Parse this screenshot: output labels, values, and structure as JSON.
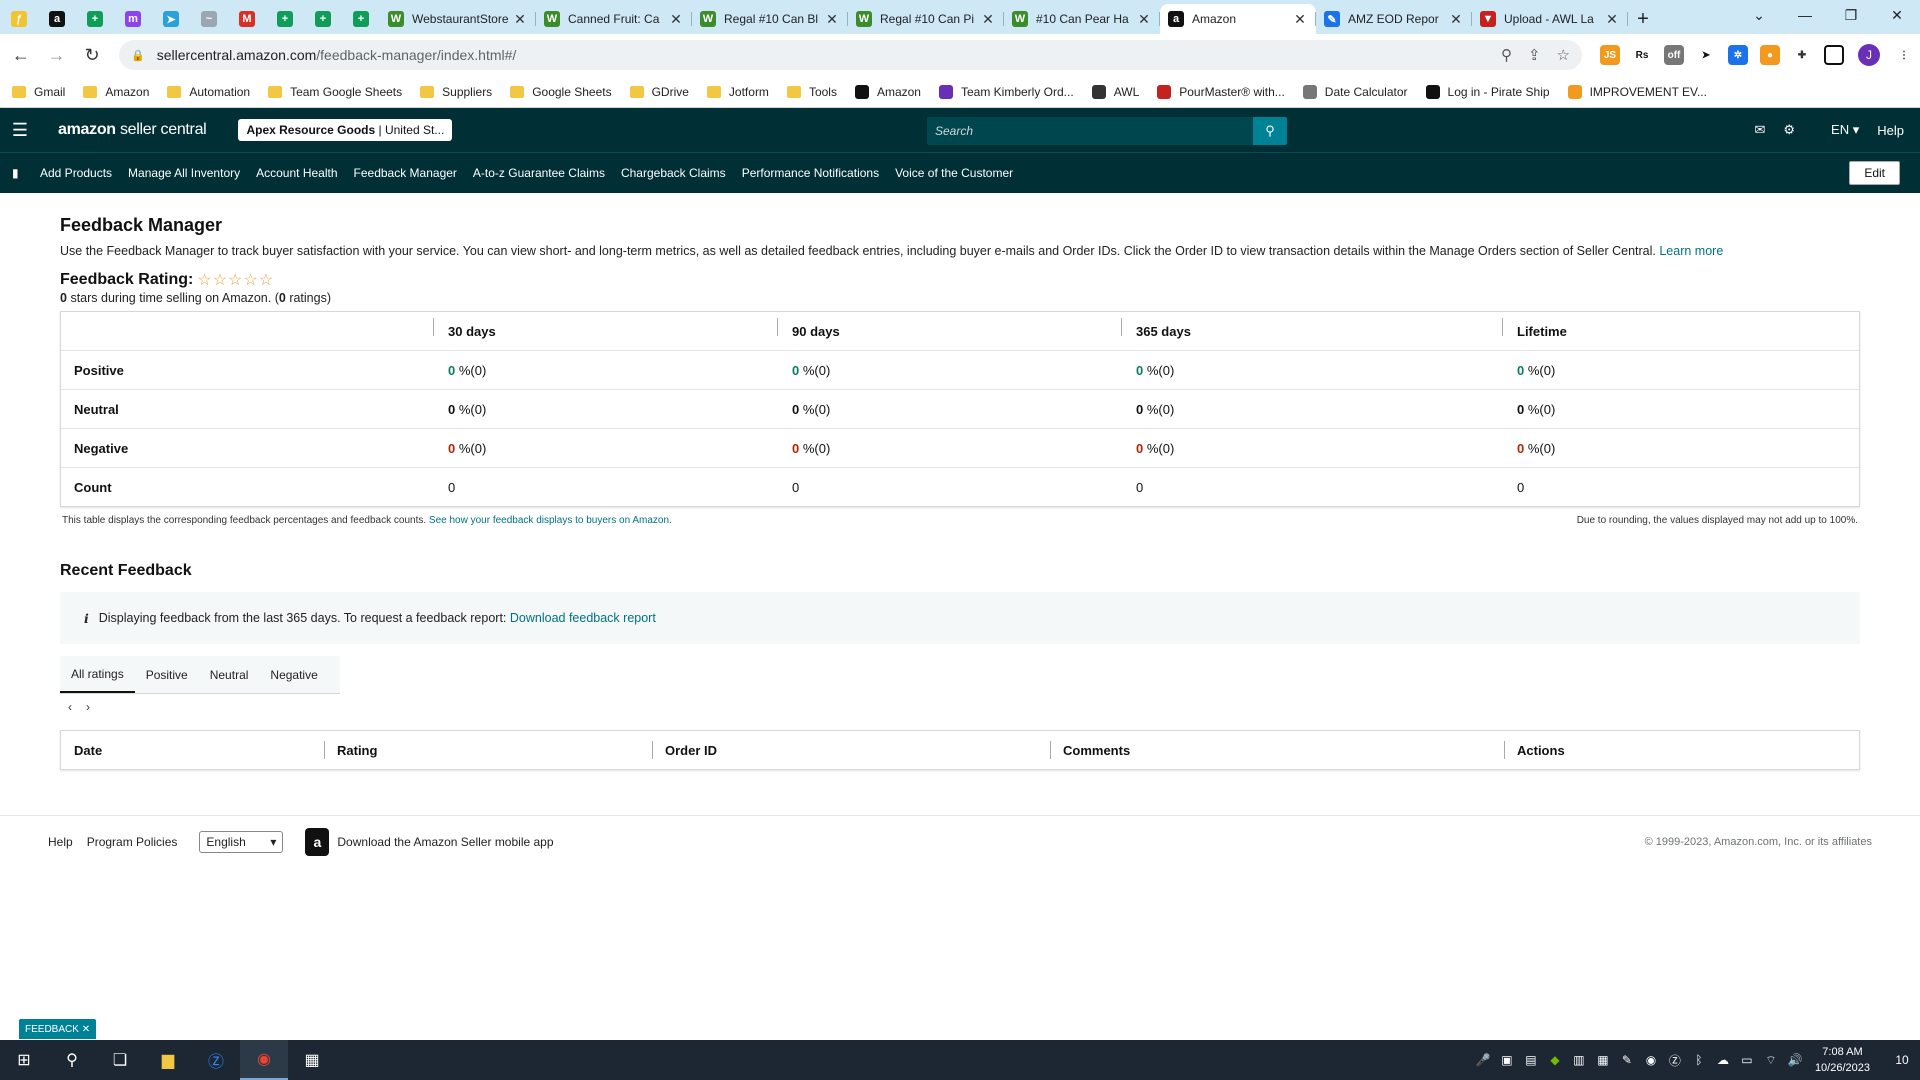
{
  "browser": {
    "pinned_tabs": [
      {
        "icon": "pinned-tab-icon",
        "glyph": "ƒ",
        "color": "#f4c430"
      },
      {
        "icon": "amazon-icon",
        "glyph": "a",
        "color": "#111111"
      },
      {
        "icon": "sheets-icon",
        "glyph": "+",
        "color": "#0f9d58"
      },
      {
        "icon": "messenger-icon",
        "glyph": "m",
        "color": "#8e44ec"
      },
      {
        "icon": "telegram-icon",
        "glyph": "➤",
        "color": "#2aa1da"
      },
      {
        "icon": "extension-icon",
        "glyph": "~",
        "color": "#9aa6b2"
      },
      {
        "icon": "gmail-icon",
        "glyph": "M",
        "color": "#d93025"
      },
      {
        "icon": "sheets-icon",
        "glyph": "+",
        "color": "#0f9d58"
      },
      {
        "icon": "sheets-icon",
        "glyph": "+",
        "color": "#0f9d58"
      },
      {
        "icon": "sheets-icon",
        "glyph": "+",
        "color": "#0f9d58"
      }
    ],
    "tabs": [
      {
        "title": "WebstaurantStore",
        "color": "#3b8c2a",
        "glyph": "W",
        "active": false
      },
      {
        "title": "Canned Fruit: Ca",
        "color": "#3b8c2a",
        "glyph": "W",
        "active": false
      },
      {
        "title": "Regal #10 Can Bl",
        "color": "#3b8c2a",
        "glyph": "W",
        "active": false
      },
      {
        "title": "Regal #10 Can Pi",
        "color": "#3b8c2a",
        "glyph": "W",
        "active": false
      },
      {
        "title": "#10 Can Pear Ha",
        "color": "#3b8c2a",
        "glyph": "W",
        "active": false
      },
      {
        "title": "Amazon",
        "color": "#111111",
        "glyph": "a",
        "active": true
      },
      {
        "title": "AMZ EOD Repor",
        "color": "#1a73e8",
        "glyph": "✎",
        "active": false
      },
      {
        "title": "Upload - AWL La",
        "color": "#c5221f",
        "glyph": "▼",
        "active": false
      }
    ],
    "url_domain": "sellercentral.amazon.com",
    "url_path": "/feedback-manager/index.html#/",
    "profile_initial": "J",
    "bookmarks": [
      {
        "label": "Gmail",
        "type": "folder"
      },
      {
        "label": "Amazon",
        "type": "folder"
      },
      {
        "label": "Automation",
        "type": "folder"
      },
      {
        "label": "Team Google Sheets",
        "type": "folder"
      },
      {
        "label": "Suppliers",
        "type": "folder"
      },
      {
        "label": "Google Sheets",
        "type": "folder"
      },
      {
        "label": "GDrive",
        "type": "folder"
      },
      {
        "label": "Jotform",
        "type": "folder"
      },
      {
        "label": "Tools",
        "type": "folder"
      },
      {
        "label": "Amazon",
        "type": "amazon"
      },
      {
        "label": "Team Kimberly Ord...",
        "type": "form"
      },
      {
        "label": "AWL",
        "type": "globe"
      },
      {
        "label": "PourMaster® with...",
        "type": "pour"
      },
      {
        "label": "Date Calculator",
        "type": "calc"
      },
      {
        "label": "Log in - Pirate Ship",
        "type": "pirate"
      },
      {
        "label": "IMPROVEMENT EV...",
        "type": "improve"
      }
    ]
  },
  "header": {
    "logo_brand": "amazon",
    "logo_product": "seller central",
    "store_name": "Apex Resource Goods",
    "store_region": "United St...",
    "search_placeholder": "Search",
    "language": "EN",
    "help": "Help"
  },
  "nav": {
    "items": [
      "Add Products",
      "Manage All Inventory",
      "Account Health",
      "Feedback Manager",
      "A-to-z Guarantee Claims",
      "Chargeback Claims",
      "Performance Notifications",
      "Voice of the Customer"
    ],
    "edit": "Edit"
  },
  "page": {
    "title": "Feedback Manager",
    "intro": "Use the Feedback Manager to track buyer satisfaction with your service. You can view short- and long-term metrics, as well as detailed feedback entries, including buyer e-mails and Order IDs. Click the Order ID to view transaction details within the Manage Orders section of Seller Central.",
    "learn_more": "Learn more",
    "rating_label": "Feedback Rating:",
    "stars": "☆☆☆☆☆",
    "rating_stars_value": "0",
    "rating_sub_text": "stars during time selling on Amazon. (",
    "rating_count": "0",
    "rating_sub_end": "ratings)"
  },
  "metrics": {
    "columns": [
      "30 days",
      "90 days",
      "365 days",
      "Lifetime"
    ],
    "rows": [
      {
        "label": "Positive",
        "kind": "pos",
        "values": [
          "0",
          "0",
          "0",
          "0"
        ],
        "counts": [
          "%(0)",
          "%(0)",
          "%(0)",
          "%(0)"
        ]
      },
      {
        "label": "Neutral",
        "kind": "neu",
        "values": [
          "0",
          "0",
          "0",
          "0"
        ],
        "counts": [
          "%(0)",
          "%(0)",
          "%(0)",
          "%(0)"
        ]
      },
      {
        "label": "Negative",
        "kind": "neg",
        "values": [
          "0",
          "0",
          "0",
          "0"
        ],
        "counts": [
          "%(0)",
          "%(0)",
          "%(0)",
          "%(0)"
        ]
      }
    ],
    "count_label": "Count",
    "count_values": [
      "0",
      "0",
      "0",
      "0"
    ],
    "note_left": "This table displays the corresponding feedback percentages and feedback counts.",
    "note_link": "See how your feedback displays to buyers on Amazon.",
    "note_right": "Due to rounding, the values displayed may not add up to 100%."
  },
  "recent": {
    "title": "Recent Feedback",
    "alert_text": "Displaying feedback from the last 365 days. To request a feedback report:",
    "alert_link": "Download feedback report",
    "tabs": [
      "All ratings",
      "Positive",
      "Neutral",
      "Negative"
    ],
    "active_tab": "All ratings",
    "columns": [
      "Date",
      "Rating",
      "Order ID",
      "Comments",
      "Actions"
    ]
  },
  "footer": {
    "help": "Help",
    "policies": "Program Policies",
    "language": "English",
    "app_text": "Download the Amazon Seller mobile app",
    "copyright": "© 1999-2023, Amazon.com, Inc. or its affiliates",
    "feedback_tab": "FEEDBACK"
  },
  "taskbar": {
    "time": "7:08 AM",
    "date": "10/26/2023",
    "notifications": "10"
  },
  "colors": {
    "header_bg": "#002f36",
    "search_btn": "#008296",
    "positive": "#067d62",
    "negative": "#b12704",
    "link": "#007185"
  }
}
